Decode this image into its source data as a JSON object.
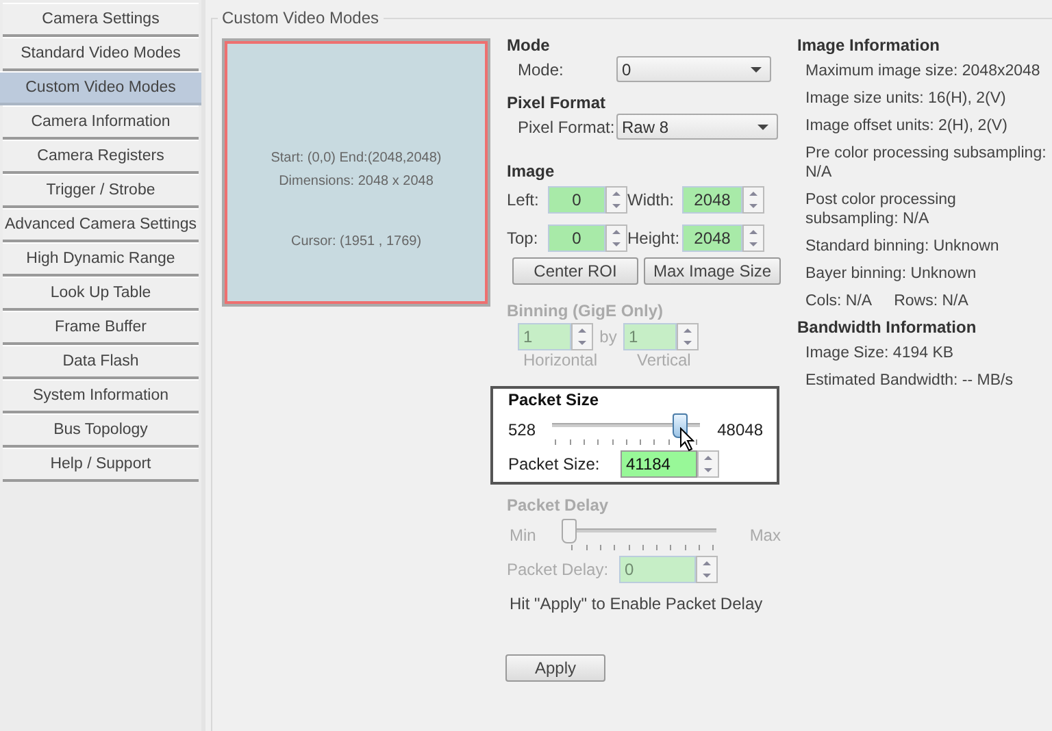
{
  "sidebar": {
    "items": [
      {
        "label": "Camera Settings",
        "selected": false
      },
      {
        "label": "Standard Video Modes",
        "selected": false
      },
      {
        "label": "Custom Video Modes",
        "selected": true
      },
      {
        "label": "Camera Information",
        "selected": false
      },
      {
        "label": "Camera Registers",
        "selected": false
      },
      {
        "label": "Trigger / Strobe",
        "selected": false
      },
      {
        "label": "Advanced Camera Settings",
        "selected": false
      },
      {
        "label": "High Dynamic Range",
        "selected": false
      },
      {
        "label": "Look Up Table",
        "selected": false
      },
      {
        "label": "Frame Buffer",
        "selected": false
      },
      {
        "label": "Data Flash",
        "selected": false
      },
      {
        "label": "System Information",
        "selected": false
      },
      {
        "label": "Bus Topology",
        "selected": false
      },
      {
        "label": "Help / Support",
        "selected": false
      }
    ]
  },
  "panel": {
    "title": "Custom Video Modes"
  },
  "preview": {
    "start_end": "Start: (0,0) End:(2048,2048)",
    "dimensions": "Dimensions: 2048 x 2048",
    "cursor": "Cursor: (1951 , 1769)"
  },
  "mode": {
    "heading": "Mode",
    "label": "Mode:",
    "value": "0"
  },
  "pixel_format": {
    "heading": "Pixel Format",
    "label": "Pixel Format:",
    "value": "Raw 8"
  },
  "image": {
    "heading": "Image",
    "fields": [
      {
        "label": "Left:",
        "value": "0"
      },
      {
        "label": "Width:",
        "value": "2048"
      },
      {
        "label": "Top:",
        "value": "0"
      },
      {
        "label": "Height:",
        "value": "2048"
      }
    ],
    "buttons": [
      "Center ROI",
      "Max Image Size"
    ]
  },
  "binning": {
    "heading": "Binning (GigE Only)",
    "disabled": true,
    "horizontal_value": "1",
    "by": "by",
    "vertical_value": "1",
    "horizontal_label": "Horizontal",
    "vertical_label": "Vertical"
  },
  "packet_size": {
    "heading": "Packet Size",
    "min": "528",
    "max": "48048",
    "level": 0.855,
    "label": "Packet Size:",
    "value": "41184",
    "disabled": false
  },
  "packet_delay": {
    "heading": "Packet Delay",
    "min": "Min",
    "max": "Max",
    "level": 0,
    "label": "Packet Delay:",
    "value": "0",
    "disabled": true,
    "hint": "Hit \"Apply\" to Enable Packet Delay"
  },
  "apply_button": "Apply",
  "image_information": {
    "heading": "Image Information",
    "lines": [
      [
        "Maximum image size: 2048x2048"
      ],
      [
        "Image size units: 16(H), 2(V)"
      ],
      [
        "Image offset units: 2(H), 2(V)"
      ],
      [
        "Pre color processing subsampling: N/A"
      ],
      [
        "Post color processing subsampling: N/A"
      ],
      [
        "Standard binning: Unknown"
      ],
      [
        "Bayer binning: Unknown"
      ],
      [
        "Cols: N/A",
        "Rows: N/A"
      ]
    ]
  },
  "bandwidth_information": {
    "heading": "Bandwidth Information",
    "lines": [
      [
        "Image Size: 4194 KB"
      ],
      [
        "Estimated Bandwidth: -- MB/s"
      ]
    ]
  }
}
